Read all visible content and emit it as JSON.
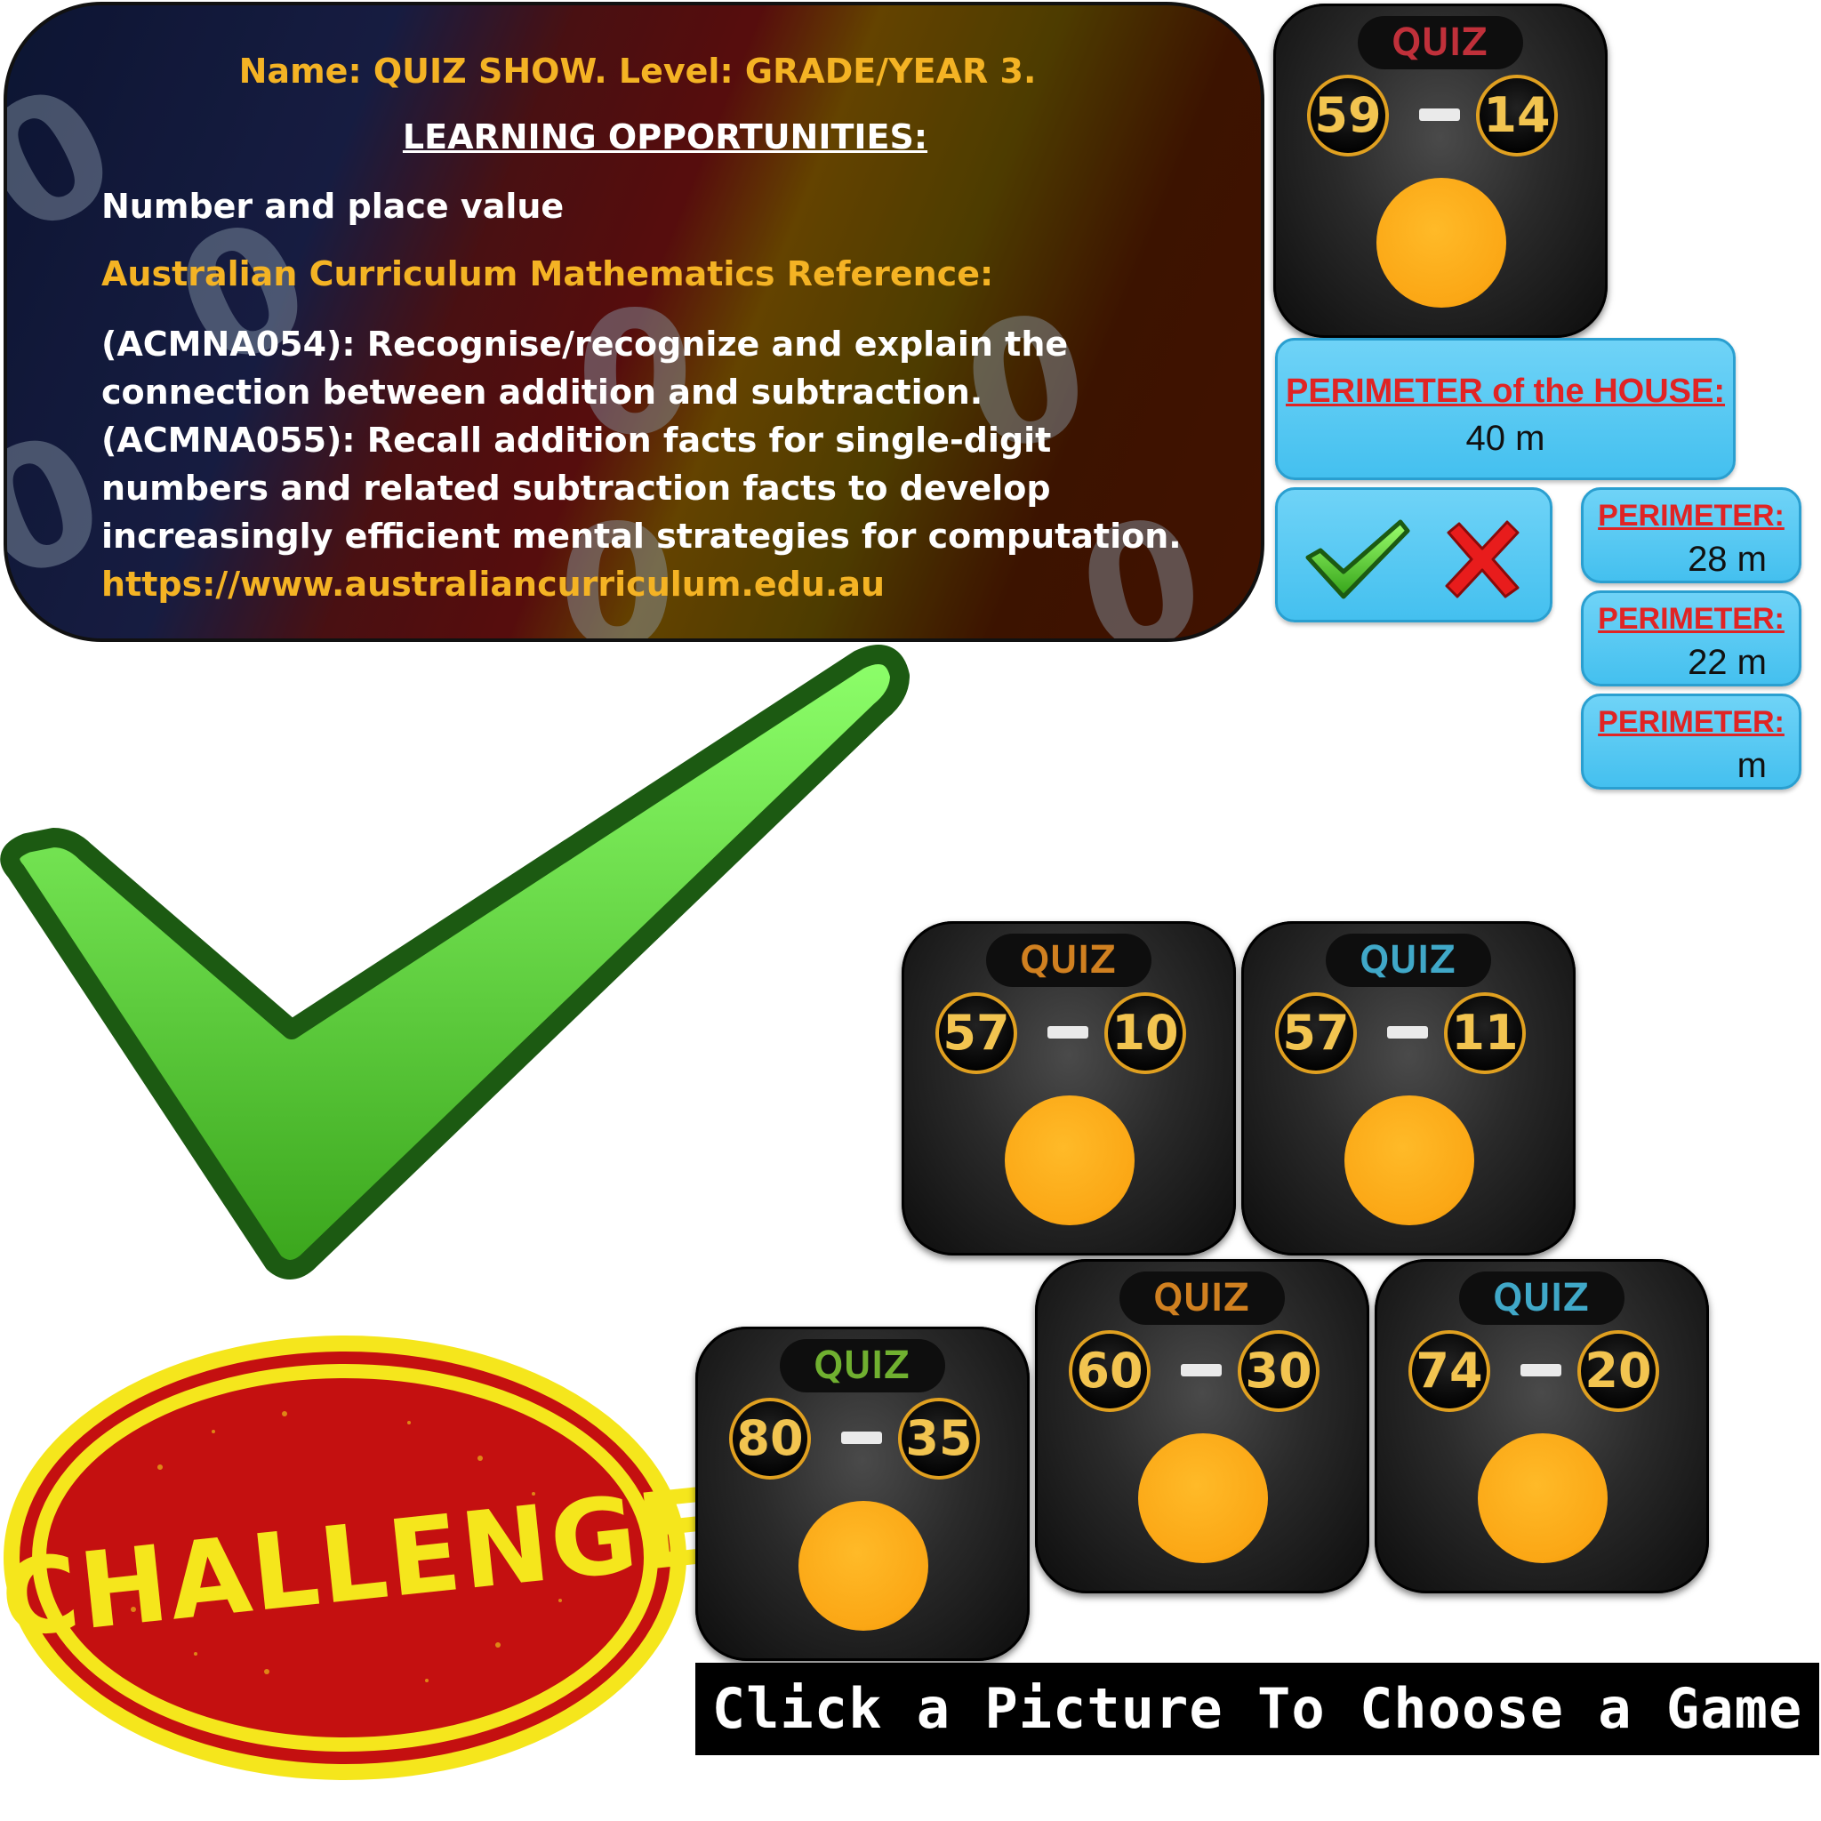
{
  "info": {
    "name_line": "Name: QUIZ SHOW. Level: GRADE/YEAR 3.",
    "learning_heading": "LEARNING OPPORTUNITIES:",
    "topic": "Number and place value",
    "reference_heading": "Australian Curriculum Mathematics Reference:",
    "reference_1": "(ACMNA054): Recognise/recognize and explain the connection between addition and subtraction.",
    "reference_2": "(ACMNA055): Recall addition facts for single-digit numbers and related subtraction facts to develop increasingly efficient mental strategies for computation.",
    "url": "https://www.australiancurriculum.edu.au"
  },
  "cards": [
    {
      "badge": "QUIZ",
      "badge_color": "#c0303a",
      "left": "59",
      "right": "14"
    },
    {
      "badge": "QUIZ",
      "badge_color": "#d08020",
      "left": "57",
      "right": "10"
    },
    {
      "badge": "QUIZ",
      "badge_color": "#40a8c8",
      "left": "57",
      "right": "11"
    },
    {
      "badge": "QUIZ",
      "badge_color": "#70b030",
      "left": "80",
      "right": "35"
    },
    {
      "badge": "QUIZ",
      "badge_color": "#d08020",
      "left": "60",
      "right": "30"
    },
    {
      "badge": "QUIZ",
      "badge_color": "#40a8c8",
      "left": "74",
      "right": "20"
    }
  ],
  "house": {
    "label": "PERIMETER of the HOUSE:",
    "value": "40 m"
  },
  "perimeters": [
    {
      "label": "PERIMETER:",
      "value": "28 m"
    },
    {
      "label": "PERIMETER:",
      "value": "22 m"
    },
    {
      "label": "PERIMETER:",
      "value": "m"
    }
  ],
  "challenge": "CHALLENGE",
  "footer": "Click a Picture To Choose a Game",
  "colors": {
    "accent_gold": "#f4b324",
    "answer_orange": "#fba715",
    "perimeter_red": "#e02424",
    "panel_blue": "#44c0ef",
    "check_green": "#5fd33a",
    "challenge_red": "#c01010",
    "challenge_yellow": "#f5e61c"
  }
}
